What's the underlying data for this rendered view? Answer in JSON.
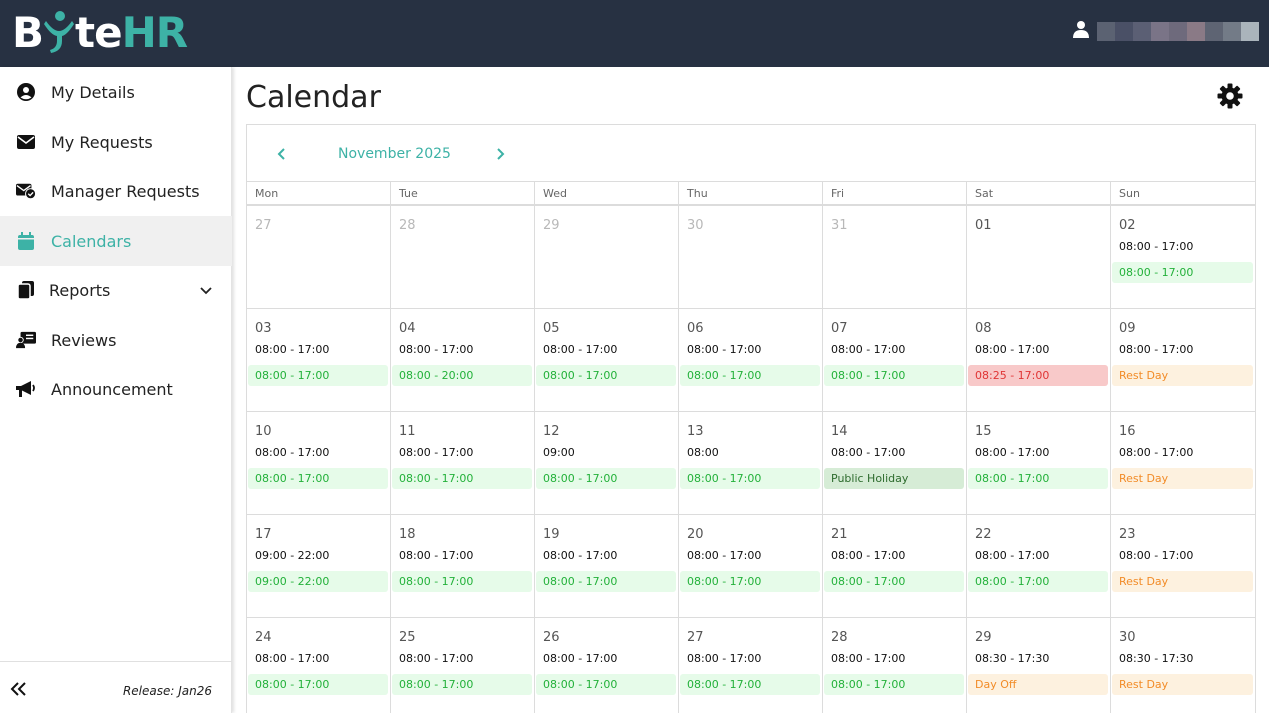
{
  "header": {
    "logo": {
      "part1": "B",
      "part2": "te",
      "part3": "HR"
    },
    "user_name_colors": [
      "#5b6272",
      "#4a5066",
      "#5b5f74",
      "#7a7487",
      "#6e6a7c",
      "#8a7a86",
      "#5e6473",
      "#737b87",
      "#aab4bb"
    ]
  },
  "sidebar": {
    "items": [
      {
        "label": "My Details",
        "icon": "user-circle-icon"
      },
      {
        "label": "My Requests",
        "icon": "envelope-icon"
      },
      {
        "label": "Manager Requests",
        "icon": "envelope-check-icon"
      },
      {
        "label": "Calendars",
        "icon": "calendar-icon",
        "active": true
      },
      {
        "label": "Reports",
        "icon": "documents-icon",
        "has_submenu": true
      },
      {
        "label": "Reviews",
        "icon": "review-icon"
      },
      {
        "label": "Announcement",
        "icon": "megaphone-icon"
      }
    ],
    "release": "Release: Jan26"
  },
  "page": {
    "title": "Calendar"
  },
  "calendar": {
    "month": "November 2025",
    "weekdays": [
      "Mon",
      "Tue",
      "Wed",
      "Thu",
      "Fri",
      "Sat",
      "Sun"
    ],
    "weeks": [
      [
        {
          "num": "27",
          "other": true
        },
        {
          "num": "28",
          "other": true
        },
        {
          "num": "29",
          "other": true
        },
        {
          "num": "30",
          "other": true
        },
        {
          "num": "31",
          "other": true
        },
        {
          "num": "01"
        },
        {
          "num": "02",
          "shift": "08:00 - 17:00",
          "att": "08:00 - 17:00",
          "status": "ok"
        }
      ],
      [
        {
          "num": "03",
          "shift": "08:00 - 17:00",
          "att": "08:00 - 17:00",
          "status": "ok"
        },
        {
          "num": "04",
          "shift": "08:00 - 17:00",
          "att": "08:00 - 20:00",
          "status": "ok"
        },
        {
          "num": "05",
          "shift": "08:00 - 17:00",
          "att": "08:00 - 17:00",
          "status": "ok"
        },
        {
          "num": "06",
          "shift": "08:00 - 17:00",
          "att": "08:00 - 17:00",
          "status": "ok"
        },
        {
          "num": "07",
          "shift": "08:00 - 17:00",
          "att": "08:00 - 17:00",
          "status": "ok"
        },
        {
          "num": "08",
          "shift": "08:00 - 17:00",
          "att": "08:25 - 17:00",
          "status": "late"
        },
        {
          "num": "09",
          "shift": "08:00 - 17:00",
          "att": "Rest Day",
          "status": "rest"
        }
      ],
      [
        {
          "num": "10",
          "shift": "08:00 - 17:00",
          "att": "08:00 - 17:00",
          "status": "ok"
        },
        {
          "num": "11",
          "shift": "08:00 - 17:00",
          "att": "08:00 - 17:00",
          "status": "ok"
        },
        {
          "num": "12",
          "shift": "09:00",
          "att": "08:00 - 17:00",
          "status": "ok"
        },
        {
          "num": "13",
          "shift": "08:00",
          "att": "08:00 - 17:00",
          "status": "ok"
        },
        {
          "num": "14",
          "shift": "08:00 - 17:00",
          "att": "Public Holiday",
          "status": "holiday"
        },
        {
          "num": "15",
          "shift": "08:00 - 17:00",
          "att": "08:00 - 17:00",
          "status": "ok"
        },
        {
          "num": "16",
          "shift": "08:00 - 17:00",
          "att": "Rest Day",
          "status": "rest"
        }
      ],
      [
        {
          "num": "17",
          "shift": "09:00 - 22:00",
          "att": "09:00 - 22:00",
          "status": "ok"
        },
        {
          "num": "18",
          "shift": "08:00 - 17:00",
          "att": "08:00 - 17:00",
          "status": "ok"
        },
        {
          "num": "19",
          "shift": "08:00 - 17:00",
          "att": "08:00 - 17:00",
          "status": "ok"
        },
        {
          "num": "20",
          "shift": "08:00 - 17:00",
          "att": "08:00 - 17:00",
          "status": "ok"
        },
        {
          "num": "21",
          "shift": "08:00 - 17:00",
          "att": "08:00 - 17:00",
          "status": "ok"
        },
        {
          "num": "22",
          "shift": "08:00 - 17:00",
          "att": "08:00 - 17:00",
          "status": "ok"
        },
        {
          "num": "23",
          "shift": "08:00 - 17:00",
          "att": "Rest Day",
          "status": "rest"
        }
      ],
      [
        {
          "num": "24",
          "shift": "08:00 - 17:00",
          "att": "08:00 - 17:00",
          "status": "ok"
        },
        {
          "num": "25",
          "shift": "08:00 - 17:00",
          "att": "08:00 - 17:00",
          "status": "ok"
        },
        {
          "num": "26",
          "shift": "08:00 - 17:00",
          "att": "08:00 - 17:00",
          "status": "ok"
        },
        {
          "num": "27",
          "shift": "08:00 - 17:00",
          "att": "08:00 - 17:00",
          "status": "ok"
        },
        {
          "num": "28",
          "shift": "08:00 - 17:00",
          "att": "08:00 - 17:00",
          "status": "ok"
        },
        {
          "num": "29",
          "shift": "08:30 - 17:30",
          "att": "Day Off",
          "status": "rest"
        },
        {
          "num": "30",
          "shift": "08:30 - 17:30",
          "att": "Rest Day",
          "status": "rest"
        }
      ]
    ]
  },
  "colors": {
    "accent": "#3db2a6",
    "topbar": "#273142"
  }
}
